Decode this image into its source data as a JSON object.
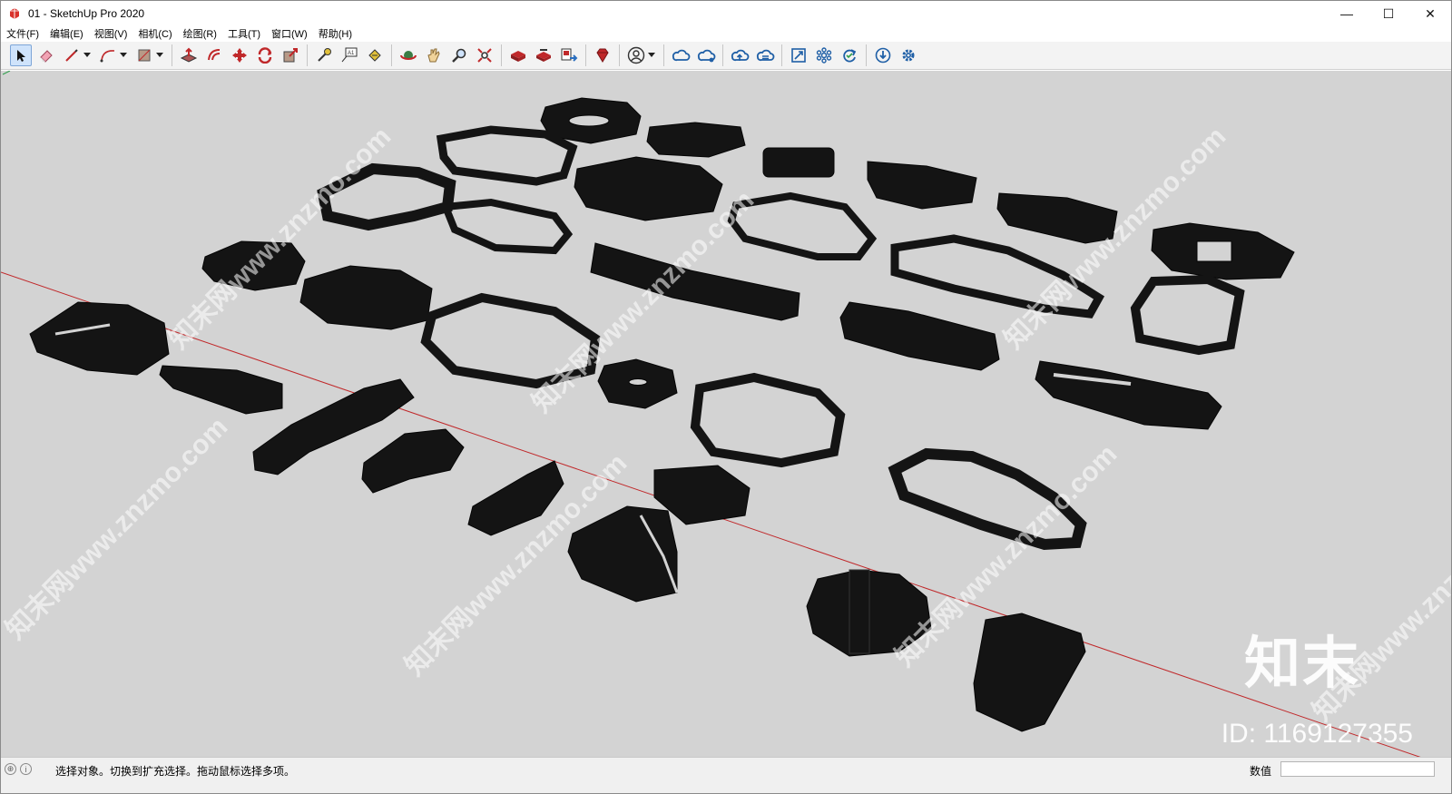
{
  "window": {
    "title": "01 - SketchUp Pro 2020",
    "controls": {
      "minimize": "—",
      "maximize": "☐",
      "close": "✕"
    }
  },
  "menu": [
    {
      "label": "文件(F)"
    },
    {
      "label": "编辑(E)"
    },
    {
      "label": "视图(V)"
    },
    {
      "label": "相机(C)"
    },
    {
      "label": "绘图(R)"
    },
    {
      "label": "工具(T)"
    },
    {
      "label": "窗口(W)"
    },
    {
      "label": "帮助(H)"
    }
  ],
  "toolbar": {
    "groups": [
      [
        "select-icon",
        "eraser-icon",
        "pencil-line-icon",
        "arc-icon",
        "rectangle-icon"
      ],
      [
        "push-pull-icon",
        "offset-icon",
        "move-icon",
        "rotate-icon",
        "scale-icon"
      ],
      [
        "tape-measure-icon",
        "text-icon",
        "paint-bucket-icon"
      ],
      [
        "orbit-icon",
        "pan-icon",
        "zoom-icon",
        "zoom-extents-icon"
      ],
      [
        "3d-warehouse-icon",
        "extension-warehouse-icon",
        "send-to-layout-icon"
      ],
      [
        "extension-manager-icon"
      ],
      [
        "account-icon"
      ],
      [
        "trimble-connect-icon",
        "cloud-share-icon",
        "cloud-upload-icon",
        "cloud-sync-icon"
      ],
      [
        "scale-view-icon",
        "components-icon",
        "refresh-icon"
      ],
      [
        "download-icon",
        "settings-icon"
      ]
    ],
    "active_tool": "select-icon"
  },
  "viewport": {
    "background": "#d3d3d3",
    "axis_color": "#c0282a",
    "watermarks": [
      "知末网www.znzmo.com",
      "知末网www.znzmo.com",
      "知末网www.znzmo.com",
      "知末网www.znzmo.com",
      "知末网www.znzmo.com",
      "知末网www.znzmo.com",
      "知末网www.znzmo.com"
    ],
    "brand": "知末",
    "id_label": "ID: 1169127355"
  },
  "status": {
    "message": "选择对象。切换到扩充选择。拖动鼠标选择多项。",
    "measure_label": "数值",
    "measure_value": ""
  }
}
